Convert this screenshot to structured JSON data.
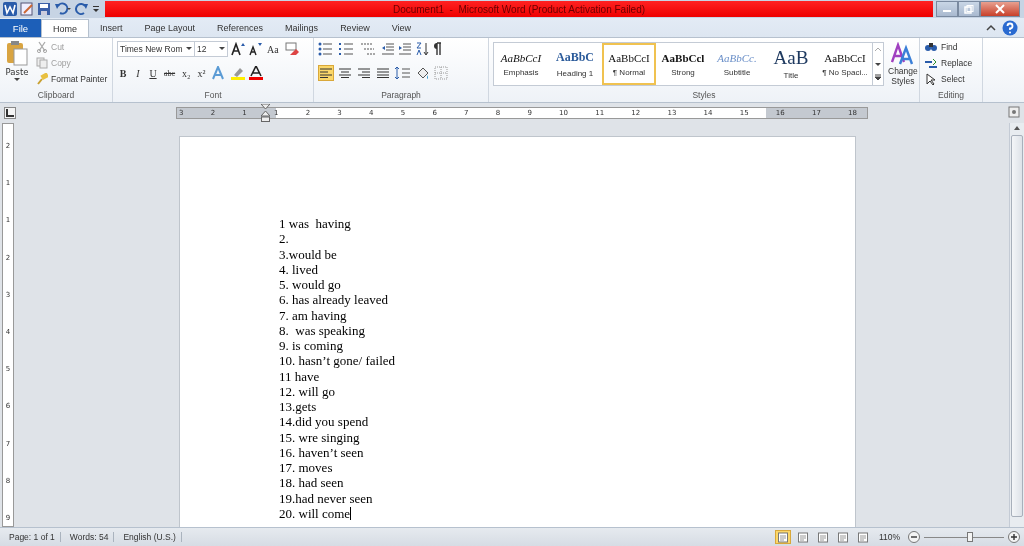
{
  "title_bar": {
    "title": "Document1  -  Microsoft Word (Product Activation Failed)"
  },
  "tabs": [
    {
      "label": "File",
      "kind": "file",
      "selected": false
    },
    {
      "label": "Home",
      "kind": "tab",
      "selected": true
    },
    {
      "label": "Insert",
      "kind": "tab",
      "selected": false
    },
    {
      "label": "Page Layout",
      "kind": "tab",
      "selected": false
    },
    {
      "label": "References",
      "kind": "tab",
      "selected": false
    },
    {
      "label": "Mailings",
      "kind": "tab",
      "selected": false
    },
    {
      "label": "Review",
      "kind": "tab",
      "selected": false
    },
    {
      "label": "View",
      "kind": "tab",
      "selected": false
    }
  ],
  "clipboard": {
    "label": "Clipboard",
    "paste": "Paste",
    "items": [
      {
        "label": "Cut",
        "disabled": true
      },
      {
        "label": "Copy",
        "disabled": true
      },
      {
        "label": "Format Painter",
        "disabled": false
      }
    ]
  },
  "font": {
    "label": "Font",
    "font_name": "Times New Rom",
    "font_size": "12",
    "change_case": "Aa",
    "format_buttons": [
      "B",
      "I",
      "U",
      "abc",
      "x₂",
      "x²"
    ]
  },
  "paragraph": {
    "label": "Paragraph",
    "alignments": [
      {
        "selected": true
      },
      {
        "selected": false
      },
      {
        "selected": false
      },
      {
        "selected": false
      }
    ]
  },
  "styles": {
    "label": "Styles",
    "change_styles": "Change Styles",
    "items": [
      {
        "preview": "AaBbCcI",
        "label": "Emphasis",
        "kind": "emphasis",
        "selected": false
      },
      {
        "preview": "AaBbC",
        "label": "Heading 1",
        "kind": "heading",
        "selected": false
      },
      {
        "preview": "AaBbCcI",
        "label": "¶ Normal",
        "kind": "normal",
        "selected": true
      },
      {
        "preview": "AaBbCcl",
        "label": "Strong",
        "kind": "strong",
        "selected": false
      },
      {
        "preview": "AaBbCc.",
        "label": "Subtitle",
        "kind": "subtitle",
        "selected": false
      },
      {
        "preview": "AaB",
        "label": "Title",
        "kind": "title",
        "selected": false
      },
      {
        "preview": "AaBbCcI",
        "label": "¶ No Spaci...",
        "kind": "normal",
        "selected": false
      }
    ]
  },
  "editing": {
    "label": "Editing",
    "items": [
      {
        "label": "Find",
        "kind": "find"
      },
      {
        "label": "Replace",
        "kind": "replace"
      },
      {
        "label": "Select",
        "kind": "select"
      }
    ]
  },
  "ruler": {
    "labels": [
      "3",
      "2",
      "1",
      "1",
      "2",
      "3",
      "4",
      "5",
      "6",
      "7",
      "8",
      "9",
      "10",
      "11",
      "12",
      "13",
      "14",
      "15",
      "16",
      "17",
      "18"
    ]
  },
  "vertical_ruler": {
    "labels": [
      "2",
      "1",
      "1",
      "2",
      "3",
      "4",
      "5",
      "6",
      "7",
      "8",
      "9"
    ]
  },
  "document": {
    "lines": [
      "1 was  having",
      "2.",
      "3.would be",
      "4. lived",
      "5. would go",
      "6. has already leaved",
      "7. am having",
      "8.  was speaking",
      "9. is coming",
      "10. hasn’t gone/ failed",
      "11 have",
      "12. will go",
      "13.gets",
      "14.did you spend",
      "15. wre singing",
      "16. haven’t seen",
      "17. moves",
      "18. had seen",
      "19.had never seen",
      "20. will come"
    ]
  },
  "status_bar": {
    "page": "Page: 1 of 1",
    "words": "Words: 54",
    "language": "English (U.S.)",
    "views": [
      {
        "selected": true
      },
      {
        "selected": false
      },
      {
        "selected": false
      },
      {
        "selected": false
      },
      {
        "selected": false
      }
    ],
    "zoom": "110%",
    "zoom_slider": {
      "level": 0.58
    }
  }
}
